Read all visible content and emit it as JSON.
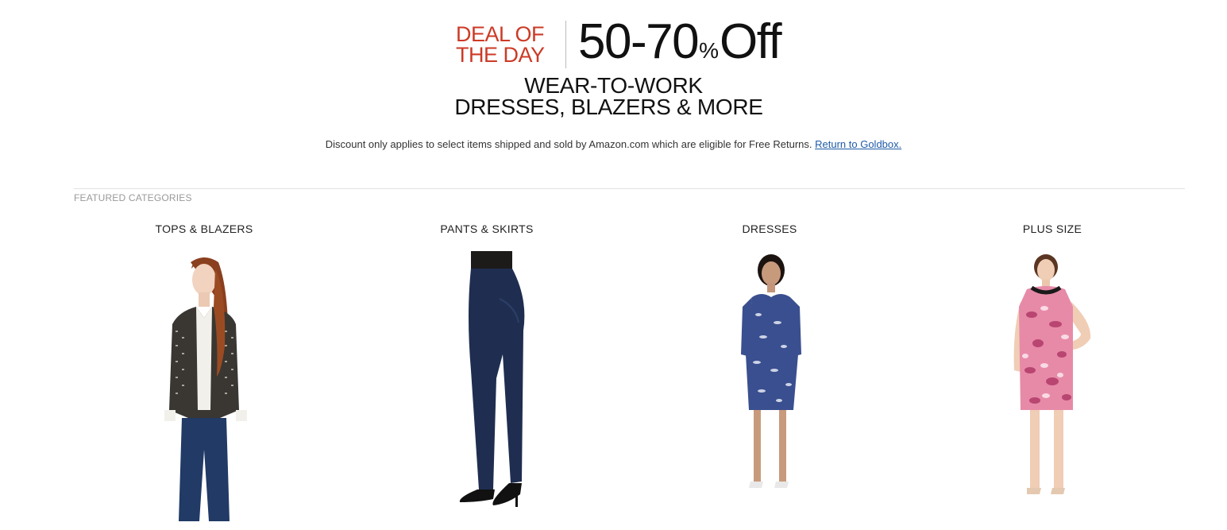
{
  "banner": {
    "deal_line1": "DEAL OF",
    "deal_line2": "THE DAY",
    "discount_range": "50-70",
    "percent_symbol": "%",
    "off": "Off",
    "subhead_line1": "WEAR-TO-WORK",
    "subhead_line2": "DRESSES, BLAZERS & MORE",
    "accent_color": "#cc3a26"
  },
  "disclaimer": {
    "text": "Discount only applies to select items shipped and sold by Amazon.com which are eligible for Free Returns.",
    "link_label": "Return to Goldbox.",
    "link_color": "#1e5aa8"
  },
  "featured": {
    "section_label": "FEATURED CATEGORIES",
    "categories": [
      {
        "label": "TOPS & BLAZERS",
        "image": "model-blazer-image"
      },
      {
        "label": "PANTS & SKIRTS",
        "image": "model-pants-image"
      },
      {
        "label": "DRESSES",
        "image": "model-dress-image"
      },
      {
        "label": "PLUS SIZE",
        "image": "model-plus-size-dress-image"
      }
    ]
  }
}
